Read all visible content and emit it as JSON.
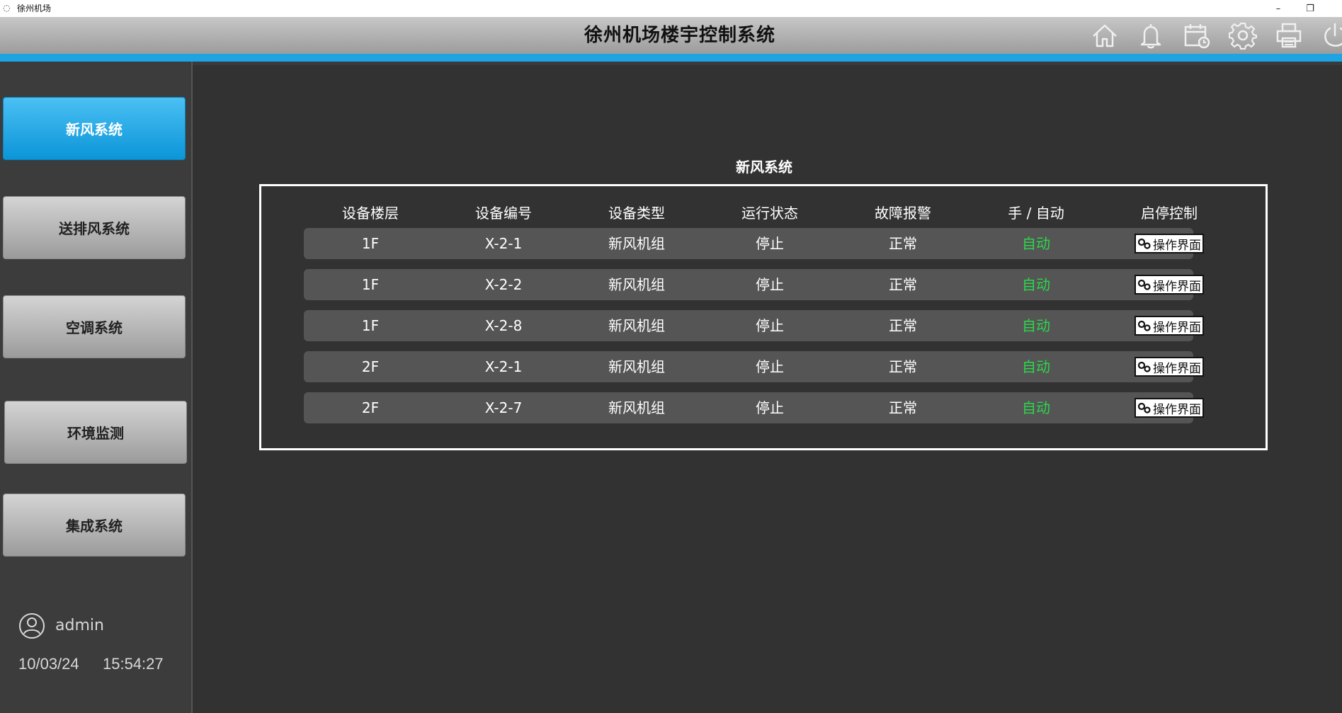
{
  "window": {
    "title": "徐州机场"
  },
  "header": {
    "title": "徐州机场楼宇控制系统",
    "icons": [
      "home-icon",
      "bell-icon",
      "calendar-icon",
      "gear-icon",
      "printer-icon",
      "power-icon"
    ]
  },
  "sidebar": {
    "items": [
      {
        "label": "新风系统",
        "active": true
      },
      {
        "label": "送排风系统",
        "active": false
      },
      {
        "label": "空调系统",
        "active": false
      },
      {
        "label": "环境监测",
        "active": false
      },
      {
        "label": "集成系统",
        "active": false
      }
    ],
    "user": "admin",
    "date": "10/03/24",
    "time": "15:54:27"
  },
  "main": {
    "title": "新风系统",
    "columns": [
      "设备楼层",
      "设备编号",
      "设备类型",
      "运行状态",
      "故障报警",
      "手 / 自动",
      "启停控制"
    ],
    "rows": [
      {
        "floor": "1F",
        "id": "X-2-1",
        "type": "新风机组",
        "status": "停止",
        "alarm": "正常",
        "mode": "自动",
        "action": "操作界面"
      },
      {
        "floor": "1F",
        "id": "X-2-2",
        "type": "新风机组",
        "status": "停止",
        "alarm": "正常",
        "mode": "自动",
        "action": "操作界面"
      },
      {
        "floor": "1F",
        "id": "X-2-8",
        "type": "新风机组",
        "status": "停止",
        "alarm": "正常",
        "mode": "自动",
        "action": "操作界面"
      },
      {
        "floor": "2F",
        "id": "X-2-1",
        "type": "新风机组",
        "status": "停止",
        "alarm": "正常",
        "mode": "自动",
        "action": "操作界面"
      },
      {
        "floor": "2F",
        "id": "X-2-7",
        "type": "新风机组",
        "status": "停止",
        "alarm": "正常",
        "mode": "自动",
        "action": "操作界面"
      }
    ]
  },
  "colors": {
    "accent": "#1ea3e3",
    "auto_text": "#2bd84a",
    "active_nav": "#0b95d8"
  }
}
